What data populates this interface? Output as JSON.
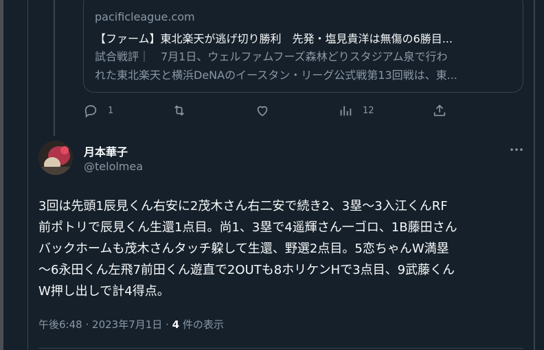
{
  "link_card": {
    "domain": "pacificleague.com",
    "title": "【ファーム】東北楽天が逃げ切り勝利　先発・塩見貴洋は無傷の6勝目...",
    "description_lines": [
      "試合戦評｜　7月1日、ウェルファムフーズ森林どりスタジアム泉で行わ",
      "れた東北楽天と横浜DeNAのイースタン・リーグ公式戦第13回戦は、東..."
    ]
  },
  "actions": {
    "reply_count": "1",
    "retweet_count": "",
    "like_count": "",
    "views_count": "12"
  },
  "tweet": {
    "author_name": "月本華子",
    "author_handle": "@telolmea",
    "text_lines": [
      "3回は先頭1辰見くん右安に2茂木さん右二安で続き2、3塁〜3入江くんRF",
      "前ポトリで辰見くん生還1点目。尚1、3塁で4遥輝さん一ゴロ、1B藤田さん",
      "バックホームも茂木さんタッチ躱して生還、野選2点目。5恋ちゃんW満塁",
      "〜6永田くん左飛7前田くん遊直で2OUTも8ホリケンHで3点目、9武藤くん",
      "W押し出しで計4得点。"
    ],
    "time": "午後6:48",
    "date": "2023年7月1日",
    "separator": "·",
    "quote_count": "4",
    "quote_label": "件の表示"
  },
  "colors": {
    "background": "#15202b",
    "text": "#f7f9f9",
    "muted": "#8b98a5",
    "border": "#38444d"
  },
  "icons": [
    "reply-icon",
    "retweet-icon",
    "like-icon",
    "views-icon",
    "share-icon",
    "more-icon"
  ]
}
